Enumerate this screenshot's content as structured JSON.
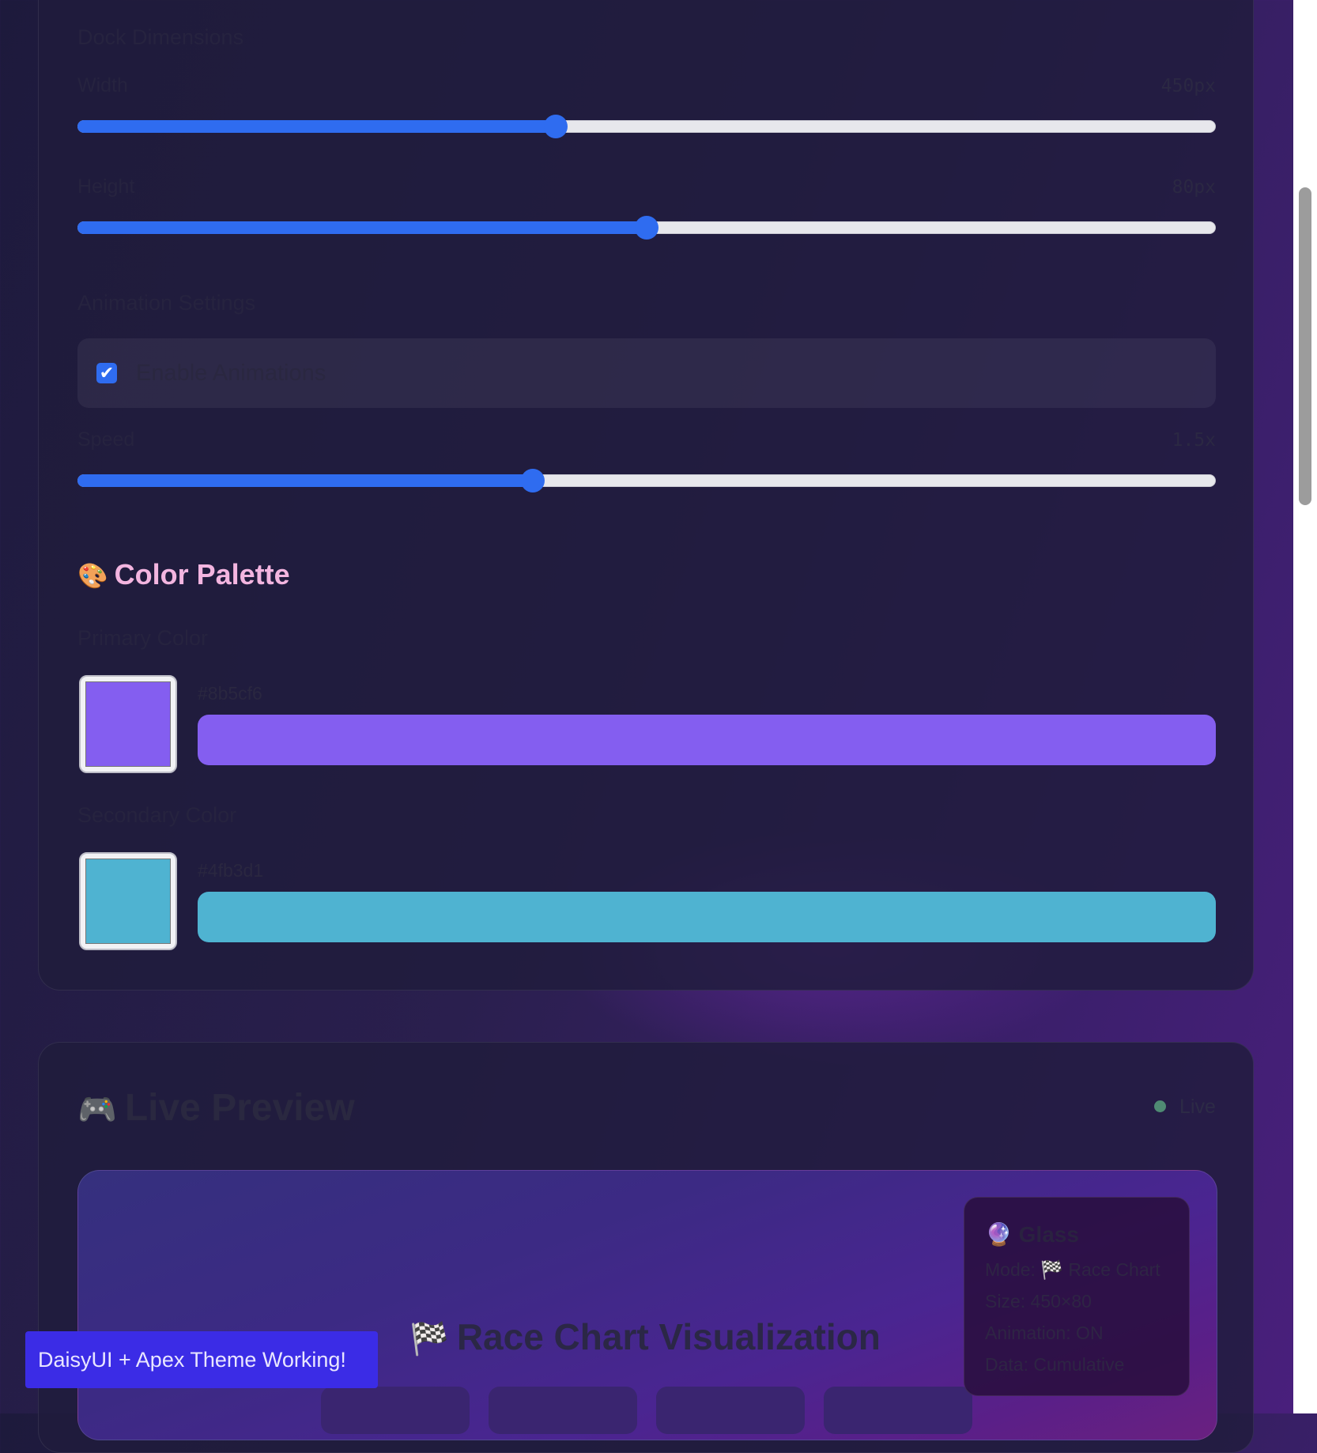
{
  "dock": {
    "section_title": "Dock Dimensions",
    "width": {
      "label": "Width",
      "value_text": "450px",
      "fraction": 0.42
    },
    "height": {
      "label": "Height",
      "value_text": "80px",
      "fraction": 0.5
    }
  },
  "animation": {
    "section_title": "Animation Settings",
    "enable_label": "Enable Animations",
    "enabled": true,
    "speed": {
      "label": "Speed",
      "value_text": "1.5x",
      "fraction": 0.4
    }
  },
  "palette": {
    "title": "Color Palette",
    "icon": "palette-icon",
    "primary": {
      "label": "Primary Color",
      "hex": "#8b5cf6",
      "color": "#845ef0"
    },
    "secondary": {
      "label": "Secondary Color",
      "hex": "#4fb3d1",
      "color": "#4fb3d1"
    }
  },
  "preview": {
    "title": "Live Preview",
    "icon": "gamepad-icon",
    "status": "Live",
    "chart_title": "Race Chart Visualization",
    "chart_icon": "checkered-flag-icon",
    "glass": {
      "title": "Glass",
      "icon": "crystal-ball-icon",
      "mode": "Mode: 🏁 Race Chart",
      "size": "Size: 450×80",
      "animation": "Animation: ON",
      "data": "Data: Cumulative"
    }
  },
  "toast": {
    "message": "DaisyUI + Apex Theme Working!"
  }
}
